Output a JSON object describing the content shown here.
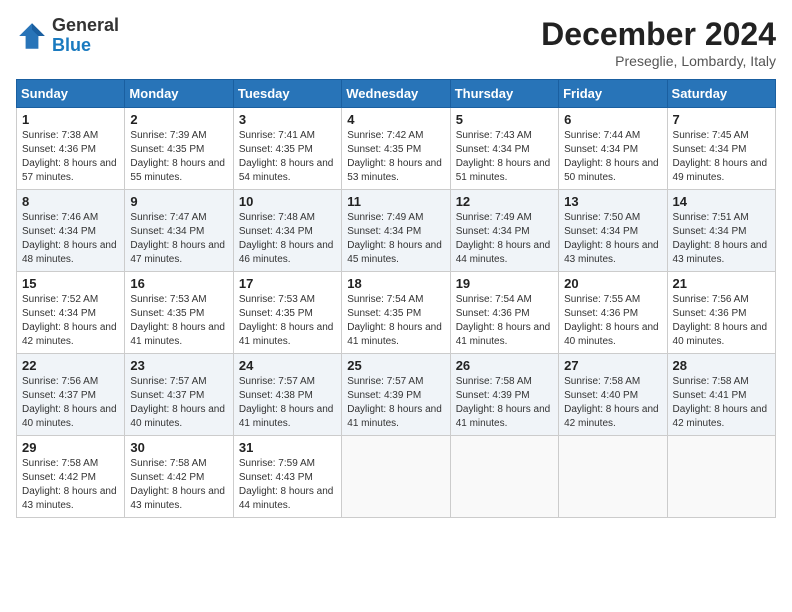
{
  "logo": {
    "text_general": "General",
    "text_blue": "Blue"
  },
  "header": {
    "month": "December 2024",
    "location": "Preseglie, Lombardy, Italy"
  },
  "days_of_week": [
    "Sunday",
    "Monday",
    "Tuesday",
    "Wednesday",
    "Thursday",
    "Friday",
    "Saturday"
  ],
  "weeks": [
    [
      {
        "day": "1",
        "sunrise": "Sunrise: 7:38 AM",
        "sunset": "Sunset: 4:36 PM",
        "daylight": "Daylight: 8 hours and 57 minutes."
      },
      {
        "day": "2",
        "sunrise": "Sunrise: 7:39 AM",
        "sunset": "Sunset: 4:35 PM",
        "daylight": "Daylight: 8 hours and 55 minutes."
      },
      {
        "day": "3",
        "sunrise": "Sunrise: 7:41 AM",
        "sunset": "Sunset: 4:35 PM",
        "daylight": "Daylight: 8 hours and 54 minutes."
      },
      {
        "day": "4",
        "sunrise": "Sunrise: 7:42 AM",
        "sunset": "Sunset: 4:35 PM",
        "daylight": "Daylight: 8 hours and 53 minutes."
      },
      {
        "day": "5",
        "sunrise": "Sunrise: 7:43 AM",
        "sunset": "Sunset: 4:34 PM",
        "daylight": "Daylight: 8 hours and 51 minutes."
      },
      {
        "day": "6",
        "sunrise": "Sunrise: 7:44 AM",
        "sunset": "Sunset: 4:34 PM",
        "daylight": "Daylight: 8 hours and 50 minutes."
      },
      {
        "day": "7",
        "sunrise": "Sunrise: 7:45 AM",
        "sunset": "Sunset: 4:34 PM",
        "daylight": "Daylight: 8 hours and 49 minutes."
      }
    ],
    [
      {
        "day": "8",
        "sunrise": "Sunrise: 7:46 AM",
        "sunset": "Sunset: 4:34 PM",
        "daylight": "Daylight: 8 hours and 48 minutes."
      },
      {
        "day": "9",
        "sunrise": "Sunrise: 7:47 AM",
        "sunset": "Sunset: 4:34 PM",
        "daylight": "Daylight: 8 hours and 47 minutes."
      },
      {
        "day": "10",
        "sunrise": "Sunrise: 7:48 AM",
        "sunset": "Sunset: 4:34 PM",
        "daylight": "Daylight: 8 hours and 46 minutes."
      },
      {
        "day": "11",
        "sunrise": "Sunrise: 7:49 AM",
        "sunset": "Sunset: 4:34 PM",
        "daylight": "Daylight: 8 hours and 45 minutes."
      },
      {
        "day": "12",
        "sunrise": "Sunrise: 7:49 AM",
        "sunset": "Sunset: 4:34 PM",
        "daylight": "Daylight: 8 hours and 44 minutes."
      },
      {
        "day": "13",
        "sunrise": "Sunrise: 7:50 AM",
        "sunset": "Sunset: 4:34 PM",
        "daylight": "Daylight: 8 hours and 43 minutes."
      },
      {
        "day": "14",
        "sunrise": "Sunrise: 7:51 AM",
        "sunset": "Sunset: 4:34 PM",
        "daylight": "Daylight: 8 hours and 43 minutes."
      }
    ],
    [
      {
        "day": "15",
        "sunrise": "Sunrise: 7:52 AM",
        "sunset": "Sunset: 4:34 PM",
        "daylight": "Daylight: 8 hours and 42 minutes."
      },
      {
        "day": "16",
        "sunrise": "Sunrise: 7:53 AM",
        "sunset": "Sunset: 4:35 PM",
        "daylight": "Daylight: 8 hours and 41 minutes."
      },
      {
        "day": "17",
        "sunrise": "Sunrise: 7:53 AM",
        "sunset": "Sunset: 4:35 PM",
        "daylight": "Daylight: 8 hours and 41 minutes."
      },
      {
        "day": "18",
        "sunrise": "Sunrise: 7:54 AM",
        "sunset": "Sunset: 4:35 PM",
        "daylight": "Daylight: 8 hours and 41 minutes."
      },
      {
        "day": "19",
        "sunrise": "Sunrise: 7:54 AM",
        "sunset": "Sunset: 4:36 PM",
        "daylight": "Daylight: 8 hours and 41 minutes."
      },
      {
        "day": "20",
        "sunrise": "Sunrise: 7:55 AM",
        "sunset": "Sunset: 4:36 PM",
        "daylight": "Daylight: 8 hours and 40 minutes."
      },
      {
        "day": "21",
        "sunrise": "Sunrise: 7:56 AM",
        "sunset": "Sunset: 4:36 PM",
        "daylight": "Daylight: 8 hours and 40 minutes."
      }
    ],
    [
      {
        "day": "22",
        "sunrise": "Sunrise: 7:56 AM",
        "sunset": "Sunset: 4:37 PM",
        "daylight": "Daylight: 8 hours and 40 minutes."
      },
      {
        "day": "23",
        "sunrise": "Sunrise: 7:57 AM",
        "sunset": "Sunset: 4:37 PM",
        "daylight": "Daylight: 8 hours and 40 minutes."
      },
      {
        "day": "24",
        "sunrise": "Sunrise: 7:57 AM",
        "sunset": "Sunset: 4:38 PM",
        "daylight": "Daylight: 8 hours and 41 minutes."
      },
      {
        "day": "25",
        "sunrise": "Sunrise: 7:57 AM",
        "sunset": "Sunset: 4:39 PM",
        "daylight": "Daylight: 8 hours and 41 minutes."
      },
      {
        "day": "26",
        "sunrise": "Sunrise: 7:58 AM",
        "sunset": "Sunset: 4:39 PM",
        "daylight": "Daylight: 8 hours and 41 minutes."
      },
      {
        "day": "27",
        "sunrise": "Sunrise: 7:58 AM",
        "sunset": "Sunset: 4:40 PM",
        "daylight": "Daylight: 8 hours and 42 minutes."
      },
      {
        "day": "28",
        "sunrise": "Sunrise: 7:58 AM",
        "sunset": "Sunset: 4:41 PM",
        "daylight": "Daylight: 8 hours and 42 minutes."
      }
    ],
    [
      {
        "day": "29",
        "sunrise": "Sunrise: 7:58 AM",
        "sunset": "Sunset: 4:42 PM",
        "daylight": "Daylight: 8 hours and 43 minutes."
      },
      {
        "day": "30",
        "sunrise": "Sunrise: 7:58 AM",
        "sunset": "Sunset: 4:42 PM",
        "daylight": "Daylight: 8 hours and 43 minutes."
      },
      {
        "day": "31",
        "sunrise": "Sunrise: 7:59 AM",
        "sunset": "Sunset: 4:43 PM",
        "daylight": "Daylight: 8 hours and 44 minutes."
      },
      null,
      null,
      null,
      null
    ]
  ]
}
